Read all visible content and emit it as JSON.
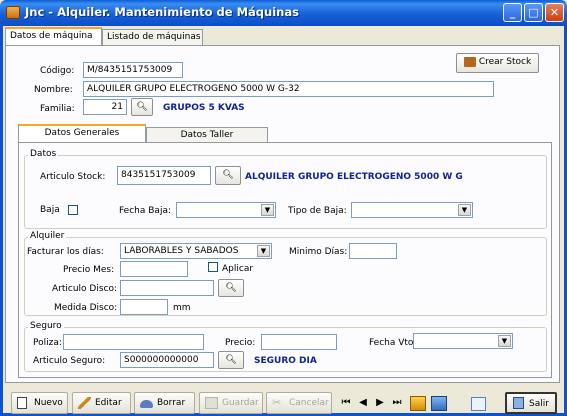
{
  "window": {
    "title": "Jnc - Alquiler. Mantenimiento de Máquinas"
  },
  "tabs": [
    "Datos de máquina",
    "Listado de máquinas"
  ],
  "header": {
    "codigo_label": "Código:",
    "codigo_value": "M/8435151753009",
    "nombre_label": "Nombre:",
    "nombre_value": "ALQUILER GRUPO ELECTROGENO 5000 W G-32",
    "familia_label": "Familia:",
    "familia_value": "21",
    "familia_desc": "GRUPOS 5 KVAS",
    "crear_stock": "Crear Stock"
  },
  "subtabs": [
    "Datos Generales",
    "Datos Taller"
  ],
  "datos": {
    "legend": "Datos",
    "articulo_label": "Articulo Stock:",
    "articulo_value": "8435151753009",
    "articulo_desc": "ALQUILER GRUPO ELECTROGENO 5000 W G",
    "baja_label": "Baja",
    "fecha_baja_label": "Fecha Baja:",
    "fecha_baja_value": "",
    "tipo_baja_label": "Tipo de Baja:",
    "tipo_baja_value": ""
  },
  "alquiler": {
    "legend": "Alquiler",
    "facturar_label": "Facturar los días:",
    "facturar_value": "LABORABLES Y SABADOS",
    "minimo_label": "Minimo Días:",
    "minimo_value": "",
    "precio_label": "Precio Mes:",
    "precio_value": "",
    "aplicar_label": "Aplicar",
    "disco_label": "Articulo Disco:",
    "disco_value": "",
    "medida_label": "Medida Disco:",
    "medida_value": "",
    "medida_unit": "mm"
  },
  "seguro": {
    "legend": "Seguro",
    "poliza_label": "Poliza:",
    "poliza_value": "",
    "precio_label": "Precio:",
    "precio_value": "",
    "fecha_label": "Fecha Vto:",
    "fecha_value": "",
    "articulo_label": "Articulo Seguro:",
    "articulo_value": "S000000000000",
    "articulo_desc": "SEGURO DIA"
  },
  "toolbar": {
    "nuevo": "Nuevo",
    "editar": "Editar",
    "borrar": "Borrar",
    "guardar": "Guardar",
    "cancelar": "Cancelar",
    "salir": "Salir"
  }
}
